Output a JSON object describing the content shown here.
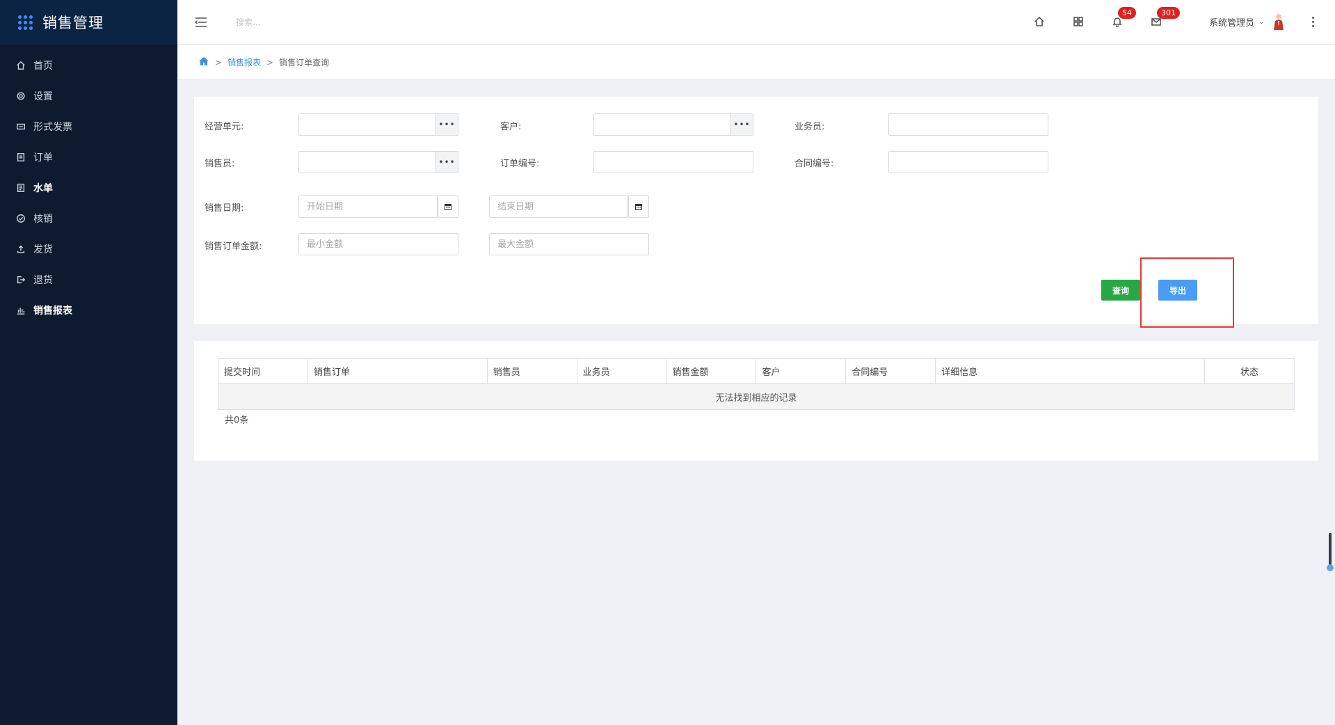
{
  "app": {
    "title": "销售管理"
  },
  "sidebar": {
    "items": [
      {
        "label": "首页",
        "icon": "home-icon"
      },
      {
        "label": "设置",
        "icon": "gear-icon"
      },
      {
        "label": "形式发票",
        "icon": "invoice-icon"
      },
      {
        "label": "订单",
        "icon": "order-icon"
      },
      {
        "label": "水单",
        "icon": "receipt-icon"
      },
      {
        "label": "核销",
        "icon": "check-circle-icon"
      },
      {
        "label": "发货",
        "icon": "upload-icon"
      },
      {
        "label": "退货",
        "icon": "logout-icon"
      },
      {
        "label": "销售报表",
        "icon": "bar-chart-icon"
      }
    ]
  },
  "header": {
    "search_placeholder": "搜索...",
    "notifications_count": "54",
    "messages_count": "301",
    "user_name": "系统管理员"
  },
  "breadcrumb": {
    "items": [
      "销售报表",
      "销售订单查询"
    ]
  },
  "form": {
    "business_unit_label": "经营单元:",
    "customer_label": "客户:",
    "salesman_label": "业务员:",
    "seller_label": "销售员:",
    "order_no_label": "订单编号:",
    "contract_no_label": "合同编号:",
    "sale_date_label": "销售日期:",
    "start_date_placeholder": "开始日期",
    "end_date_placeholder": "结束日期",
    "amount_label": "销售订单金额:",
    "min_amount_placeholder": "最小金额",
    "max_amount_placeholder": "最大金额",
    "query_button": "查询",
    "export_button": "导出"
  },
  "table": {
    "columns": [
      "提交时间",
      "销售订单",
      "销售员",
      "业务员",
      "销售金额",
      "客户",
      "合同编号",
      "详细信息",
      "状态"
    ],
    "empty_message": "无法找到相应的记录",
    "total_text": "共0条"
  },
  "colors": {
    "sidebar_bg": "#0e1a2e",
    "query_button": "#28a745",
    "export_button": "#4b9cf5",
    "highlight": "#e53935",
    "badge": "#e02020"
  }
}
